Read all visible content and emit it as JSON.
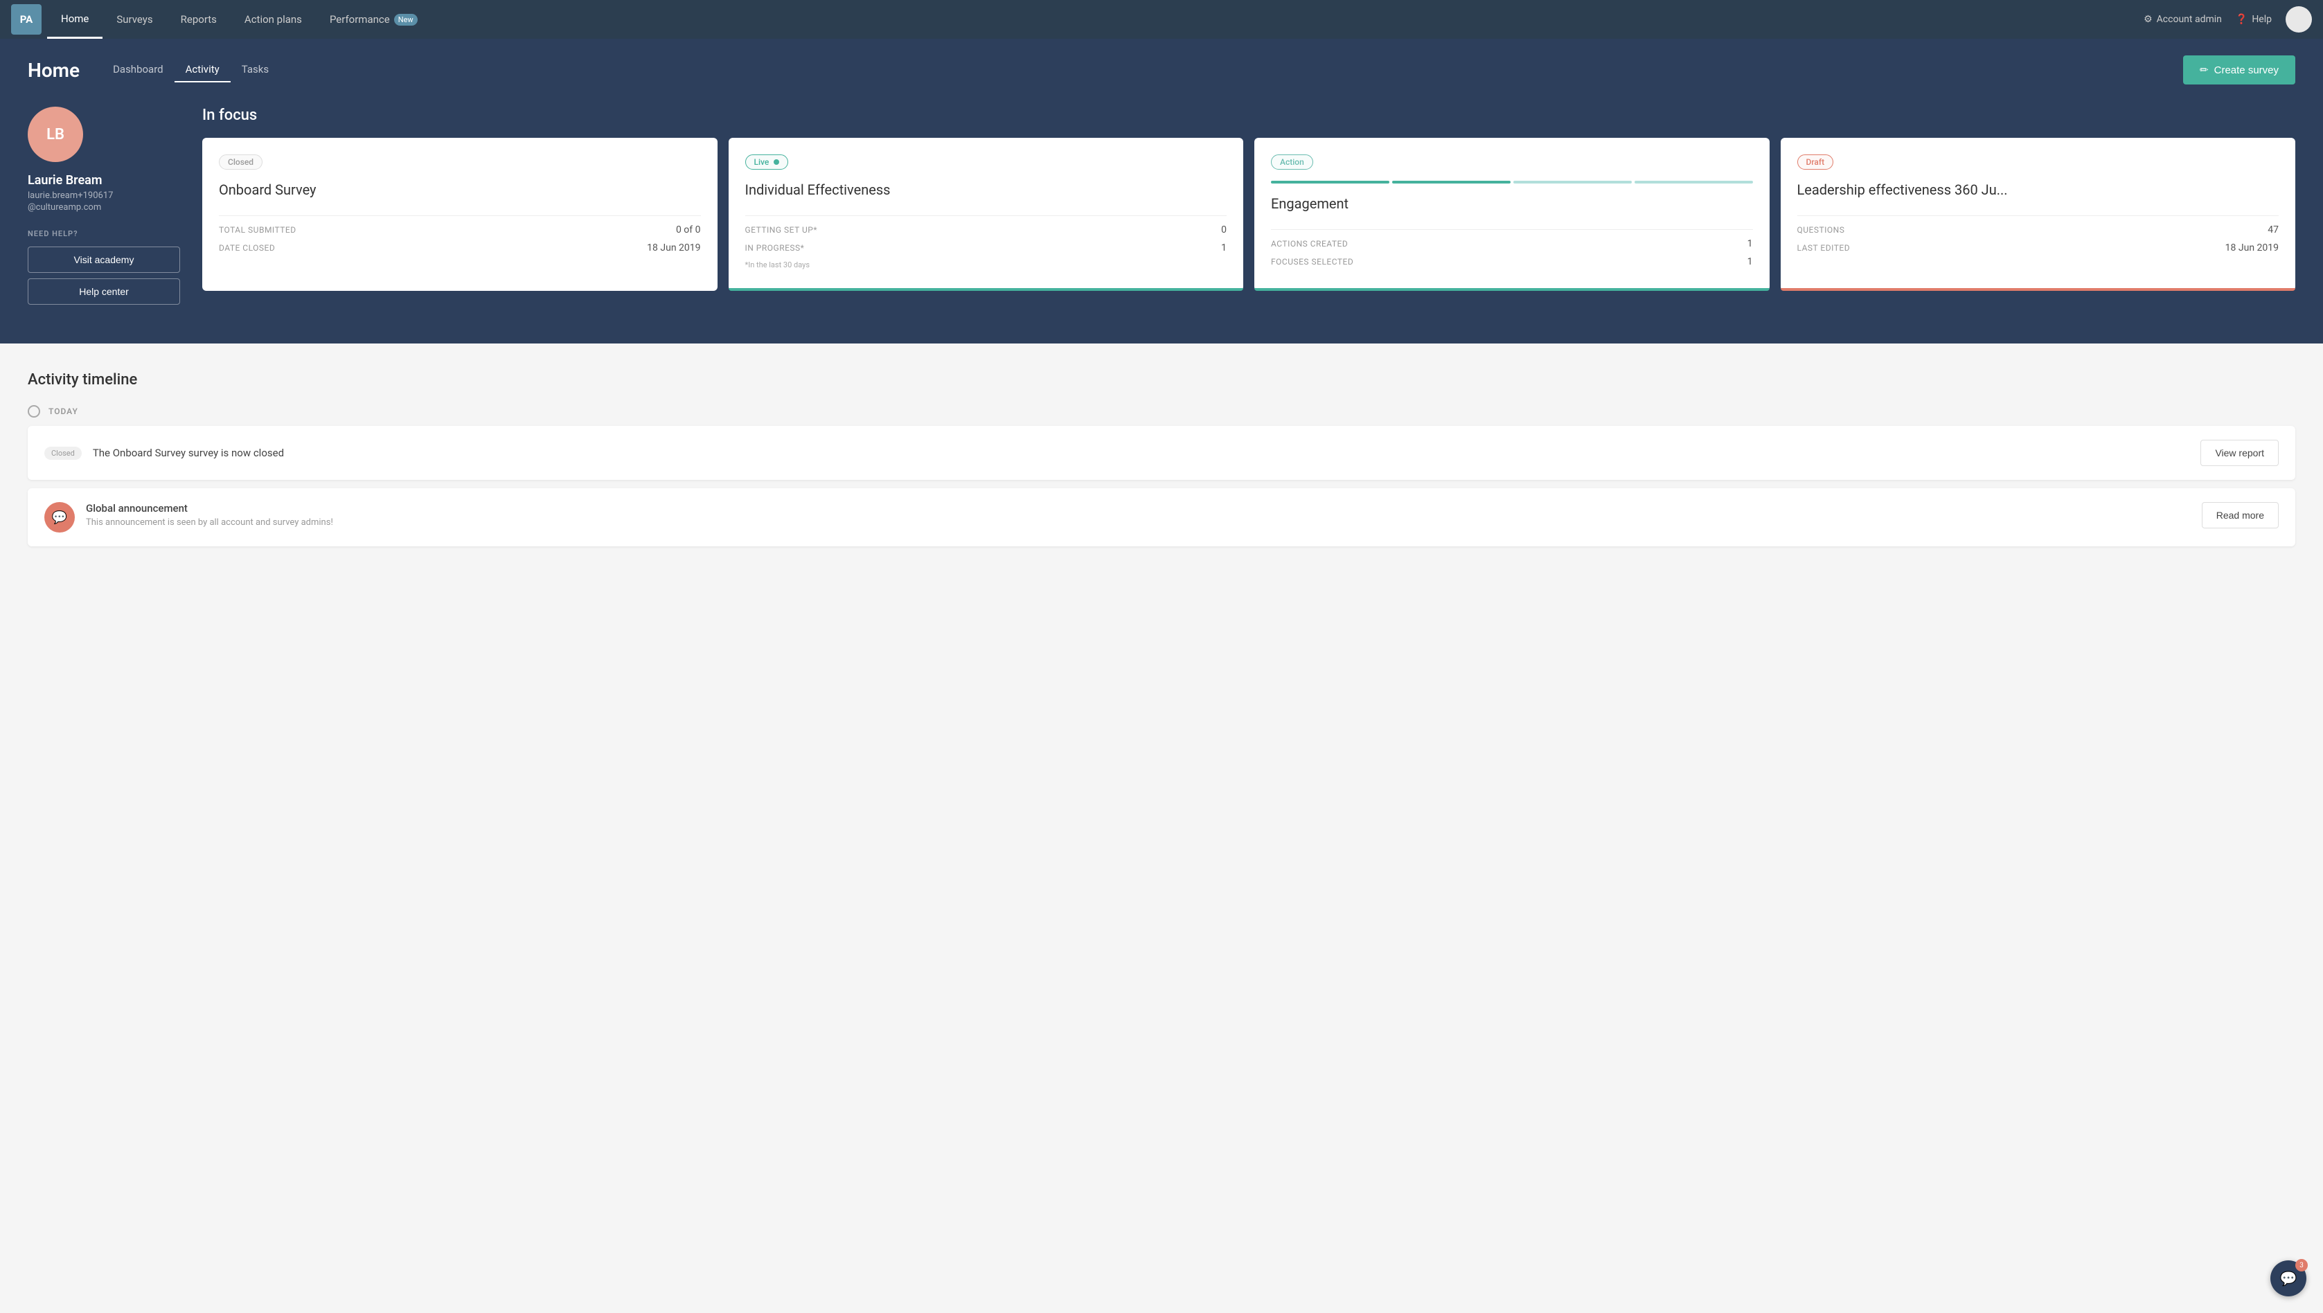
{
  "app": {
    "logo": "PA"
  },
  "nav": {
    "links": [
      {
        "id": "home",
        "label": "Home",
        "active": true
      },
      {
        "id": "surveys",
        "label": "Surveys",
        "active": false
      },
      {
        "id": "reports",
        "label": "Reports",
        "active": false
      },
      {
        "id": "action-plans",
        "label": "Action plans",
        "active": false
      },
      {
        "id": "performance",
        "label": "Performance",
        "active": false,
        "badge": "New"
      }
    ],
    "account_admin": "Account admin",
    "help": "Help"
  },
  "header": {
    "title": "Home",
    "tabs": [
      {
        "id": "dashboard",
        "label": "Dashboard",
        "active": false
      },
      {
        "id": "activity",
        "label": "Activity",
        "active": true
      },
      {
        "id": "tasks",
        "label": "Tasks",
        "active": false
      }
    ],
    "create_button": "Create survey"
  },
  "profile": {
    "initials": "LB",
    "name": "Laurie Bream",
    "email": "laurie.bream+190617",
    "domain": "@cultureamp.com",
    "need_help": "NEED HELP?",
    "visit_academy": "Visit academy",
    "help_center": "Help center"
  },
  "in_focus": {
    "title": "In focus",
    "cards": [
      {
        "id": "onboard-survey",
        "badge": "Closed",
        "badge_type": "closed",
        "title": "Onboard Survey",
        "stats": [
          {
            "label": "TOTAL SUBMITTED",
            "value": "0 of 0"
          },
          {
            "label": "DATE CLOSED",
            "value": "18 Jun 2019"
          }
        ],
        "bar_color": "none"
      },
      {
        "id": "individual-effectiveness",
        "badge": "Live",
        "badge_type": "live",
        "title": "Individual Effectiveness",
        "stats": [
          {
            "label": "GETTING SET UP*",
            "value": "0"
          },
          {
            "label": "IN PROGRESS*",
            "value": "1"
          }
        ],
        "note": "*In the last 30 days",
        "bar_color": "green"
      },
      {
        "id": "engagement",
        "badge": "Action",
        "badge_type": "action",
        "title": "Engagement",
        "stats": [
          {
            "label": "ACTIONS CREATED",
            "value": "1"
          },
          {
            "label": "FOCUSES SELECTED",
            "value": "1"
          }
        ],
        "bar_color": "green",
        "has_progress": true
      },
      {
        "id": "leadership",
        "badge": "Draft",
        "badge_type": "draft",
        "title": "Leadership effectiveness 360 Ju...",
        "stats": [
          {
            "label": "QUESTIONS",
            "value": "47"
          },
          {
            "label": "LAST EDITED",
            "value": "18 Jun 2019"
          }
        ],
        "bar_color": "orange"
      }
    ]
  },
  "activity": {
    "title": "Activity timeline",
    "date_label": "TODAY",
    "items": [
      {
        "id": "onboard-closed",
        "badge": "Closed",
        "text": "The Onboard Survey survey is now closed",
        "action": "View report"
      },
      {
        "id": "global-announcement",
        "icon": "💬",
        "title": "Global announcement",
        "description": "This announcement is seen by all account and survey admins!",
        "action": "Read more"
      }
    ]
  },
  "chat": {
    "badge_count": "3"
  }
}
